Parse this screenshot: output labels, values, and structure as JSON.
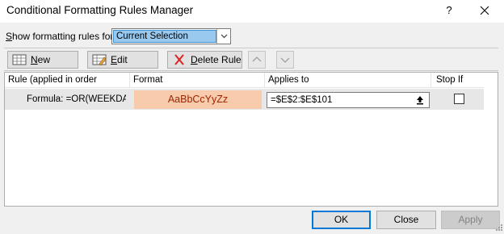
{
  "window": {
    "title": "Conditional Formatting Rules Manager",
    "help_glyph": "?",
    "close_glyph": "✕"
  },
  "show_rules": {
    "label_prefix": "",
    "label_accel": "S",
    "label_rest": "how formatting rules for:",
    "selected": "Current Selection"
  },
  "toolbar": {
    "new_rule_accel": "N",
    "new_rule_rest": "ew Rule...",
    "edit_rule_accel": "E",
    "edit_rule_rest": "dit Rule...",
    "delete_rule_accel": "D",
    "delete_rule_rest": "elete Rule"
  },
  "table": {
    "columns": [
      "Rule (applied in order shown)",
      "Format",
      "Applies to",
      "Stop If True"
    ],
    "rows": [
      {
        "rule": "Formula: =OR(WEEKDA...",
        "format_preview": "AaBbCcYyZz",
        "applies_to": "=$E$2:$E$101",
        "stop_if_true": false
      }
    ]
  },
  "footer": {
    "ok": "OK",
    "close": "Close",
    "apply": "Apply"
  },
  "colors": {
    "format_fill": "#f8cbad",
    "format_text": "#9c2500",
    "selection": "#99c9ef"
  },
  "icons": [
    "help-icon",
    "close-icon",
    "new-rule-icon",
    "edit-rule-icon",
    "delete-icon",
    "move-up-icon",
    "move-down-icon",
    "collapse-range-icon",
    "dropdown-arrow-icon",
    "resize-grip-icon"
  ]
}
